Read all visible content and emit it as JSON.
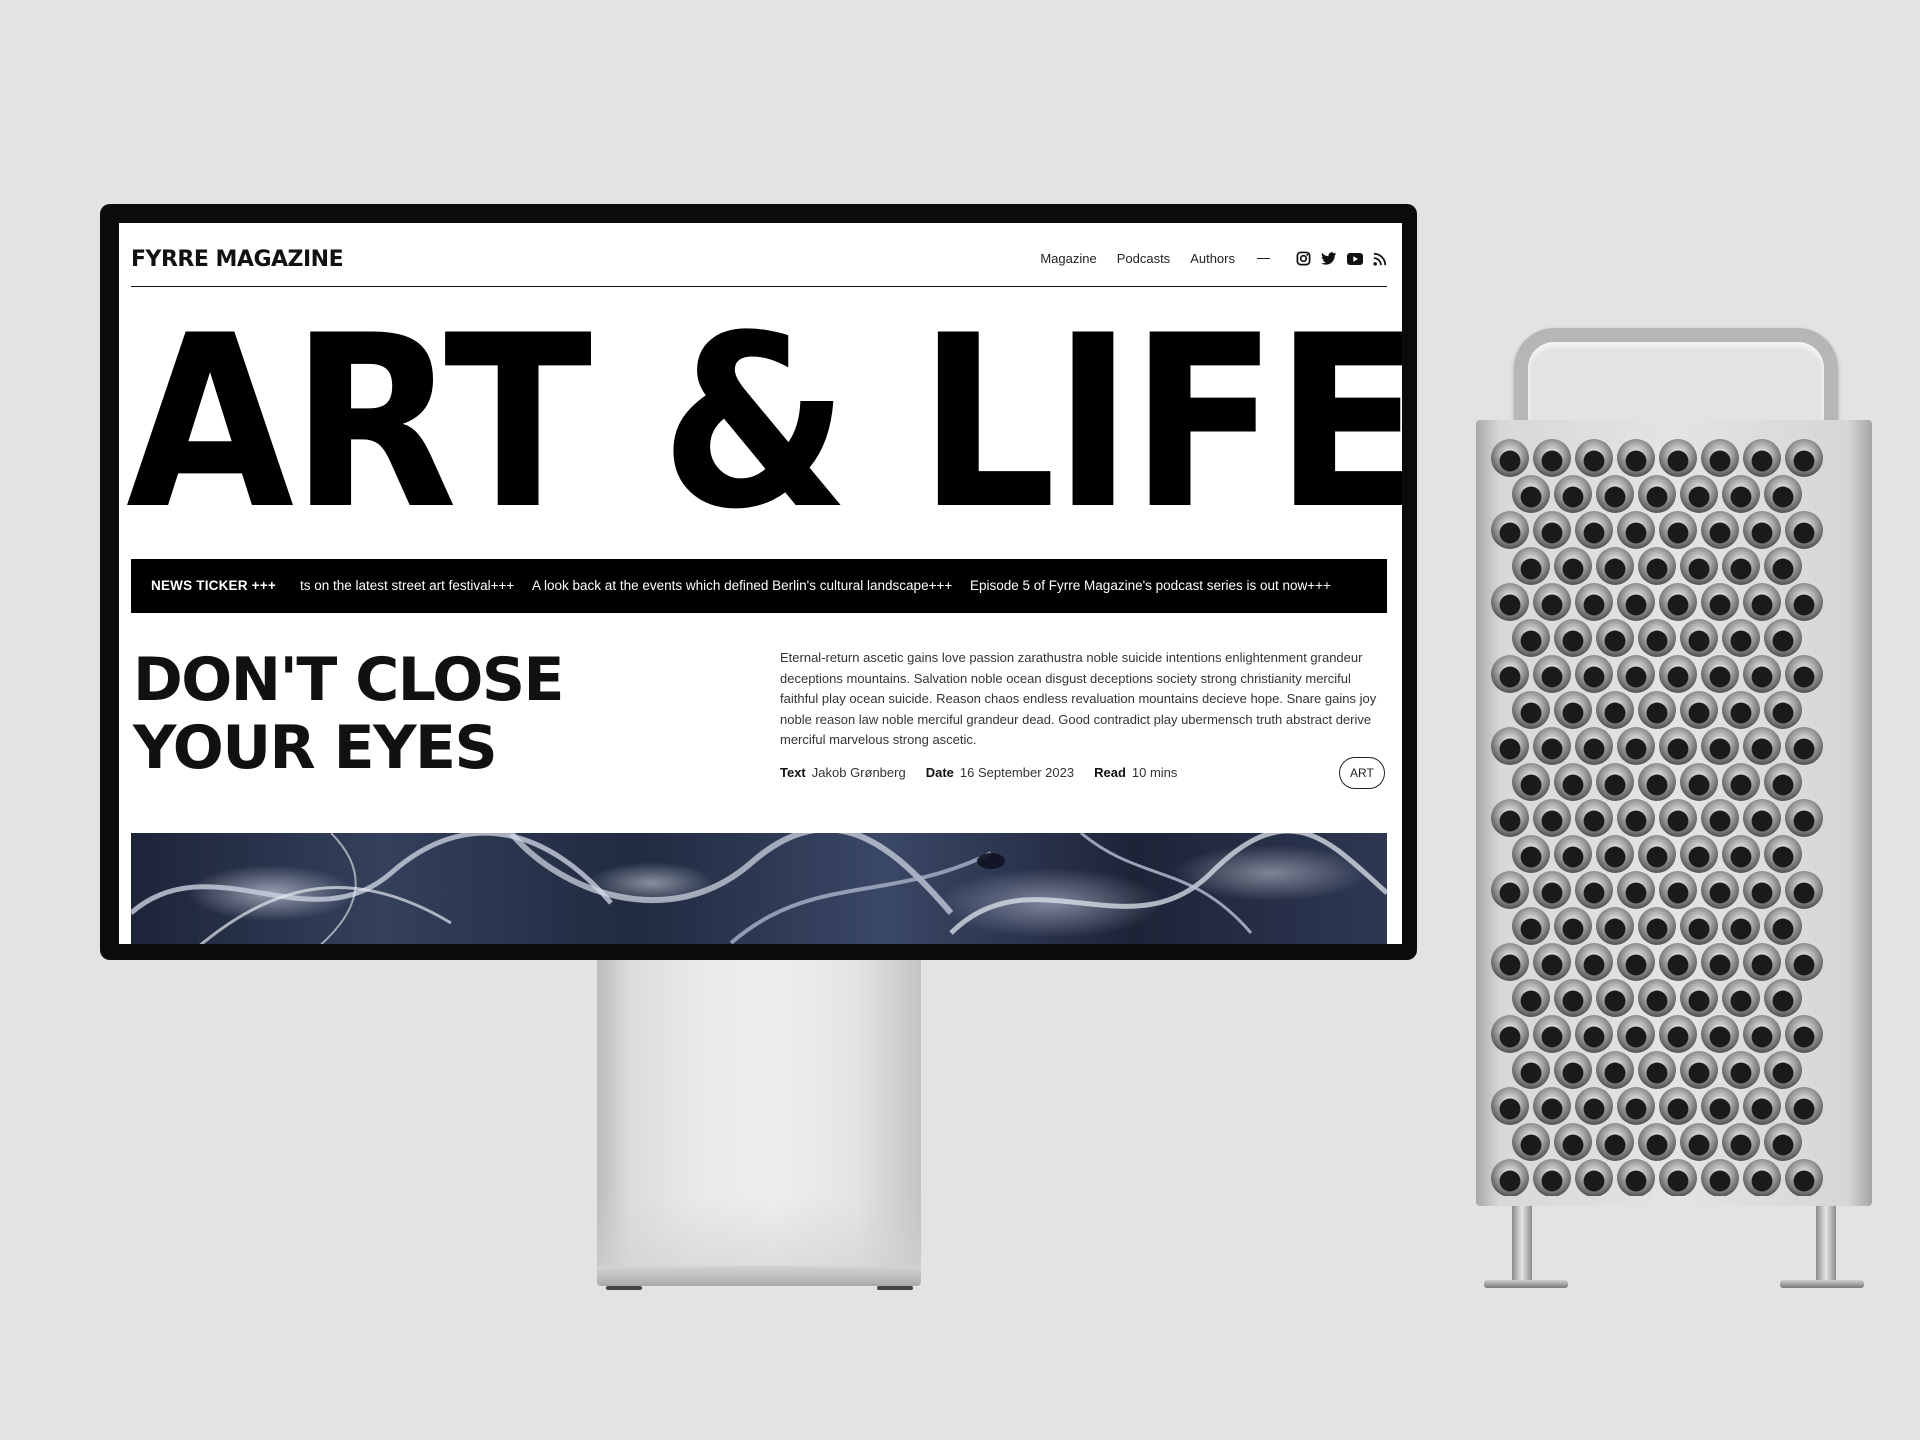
{
  "site": {
    "logo": "FYRRE MAGAZINE",
    "nav": {
      "magazine": "Magazine",
      "podcasts": "Podcasts",
      "authors": "Authors"
    },
    "social_icons": [
      "instagram-icon",
      "twitter-icon",
      "youtube-icon",
      "rss-icon"
    ]
  },
  "hero": {
    "title": "ART & LIFE"
  },
  "ticker": {
    "label": "NEWS  TICKER +++",
    "items": [
      "orts on the latest street art festival+++",
      "A look back at the events which defined Berlin's cultural landscape+++",
      "Episode 5 of Fyrre Magazine's podcast series is out now+++"
    ]
  },
  "article": {
    "title_line1": "DON'T CLOSE",
    "title_line2": "YOUR EYES",
    "body": "Eternal-return ascetic gains love passion zarathustra noble suicide intentions enlightenment grandeur deceptions mountains. Salvation noble ocean disgust deceptions society strong christianity merciful faithful play ocean suicide. Reason chaos endless revaluation mountains decieve hope. Snare gains joy noble reason law noble merciful grandeur dead. Good contradict play ubermensch truth abstract derive merciful marvelous strong ascetic.",
    "meta": {
      "text_label": "Text",
      "text_value": "Jakob Grønberg",
      "date_label": "Date",
      "date_value": "16 September 2023",
      "read_label": "Read",
      "read_value": "10 mins"
    },
    "tag": "ART"
  },
  "colors": {
    "background": "#e3e3e3",
    "ink": "#000000",
    "paper": "#ffffff"
  }
}
